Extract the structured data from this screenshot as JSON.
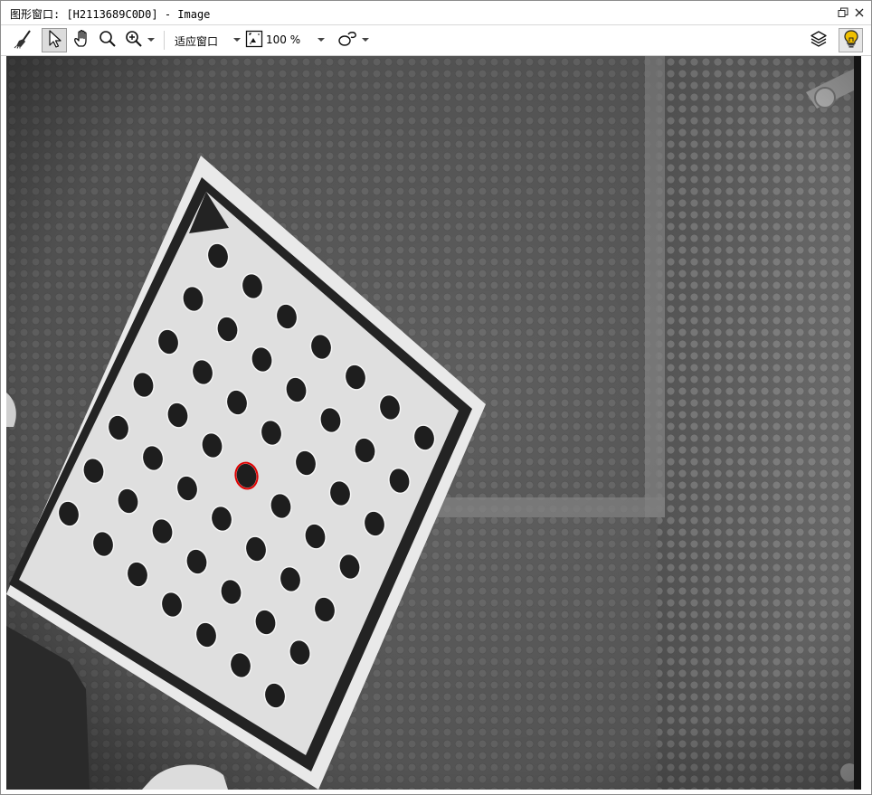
{
  "window": {
    "title": "图形窗口: [H2113689C0D0] - Image"
  },
  "toolbar": {
    "fit_label": "适应窗口",
    "zoom_label": "100 %"
  },
  "icons": {
    "clear": "broom-icon",
    "pointer": "pointer-icon",
    "pan": "hand-icon",
    "magnify": "magnifier-icon",
    "zoom": "zoom-in-icon",
    "fit": "fit-window-icon",
    "region": "draw-region-icon",
    "layers": "layers-icon",
    "help": "lightbulb-icon"
  },
  "colors": {
    "selection_outline": "#e00000",
    "help_bulb": "#f0c000"
  },
  "image": {
    "board": {
      "rows": 7,
      "cols": 7,
      "selected_dot": [
        3,
        3
      ]
    }
  }
}
